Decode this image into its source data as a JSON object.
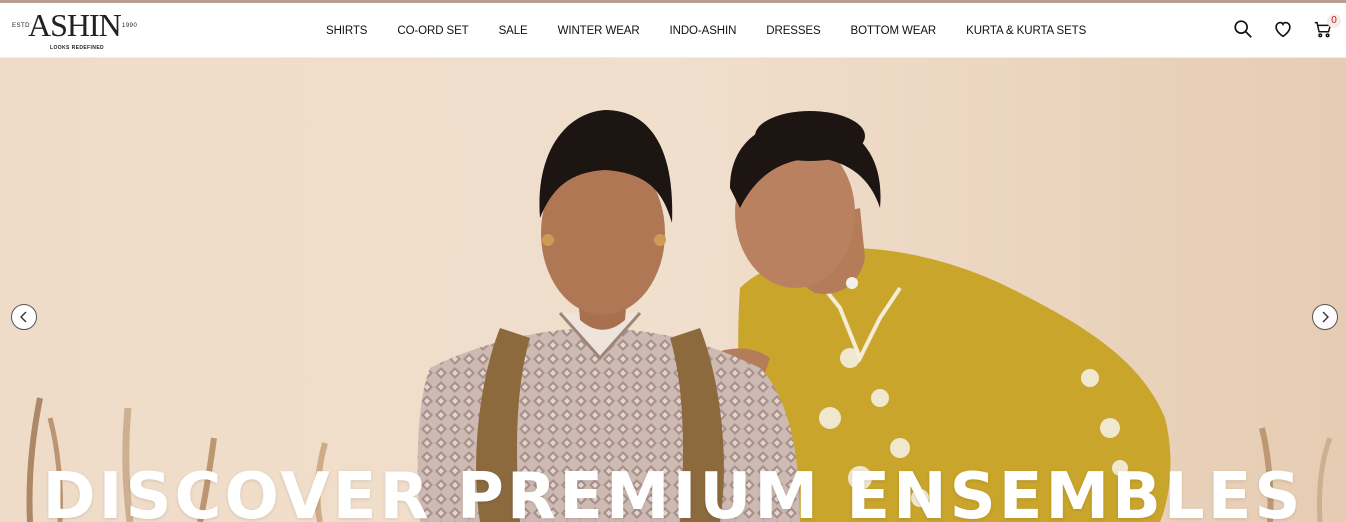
{
  "brand": {
    "estd_label": "ESTD",
    "name": "ASHIN",
    "year": "1990",
    "tagline": "LOOKS REDEFINED"
  },
  "nav": {
    "items": [
      {
        "label": "SHIRTS"
      },
      {
        "label": "CO-ORD SET"
      },
      {
        "label": "SALE"
      },
      {
        "label": "WINTER WEAR"
      },
      {
        "label": "INDO-ASHIN"
      },
      {
        "label": "DRESSES"
      },
      {
        "label": "BOTTOM WEAR"
      },
      {
        "label": "KURTA & KURTA SETS"
      }
    ]
  },
  "header_icons": {
    "search": "search-icon",
    "wishlist": "heart-icon",
    "cart": "cart-icon",
    "cart_count": "0"
  },
  "hero": {
    "headline": "DISCOVER PREMIUM ENSEMBLES",
    "prev_icon": "chevron-left-icon",
    "next_icon": "chevron-right-icon"
  },
  "colors": {
    "accent_line": "#b99c92",
    "hero_background": "#ead3bd",
    "kurta_yellow": "#c9a52c",
    "kurta_mauve": "#b8a39c"
  }
}
